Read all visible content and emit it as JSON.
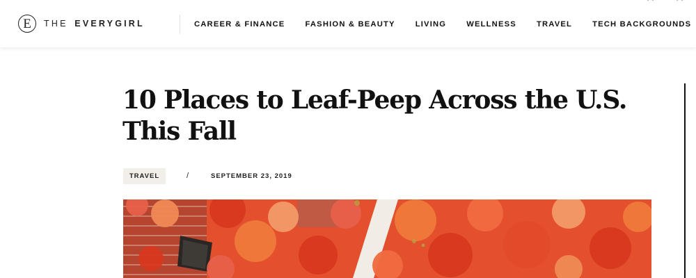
{
  "site": {
    "logo_letter": "E",
    "logo_prefix": "THE",
    "logo_name": "EVERYGIRL"
  },
  "nav": {
    "items": [
      "CAREER & FINANCE",
      "FASHION & BEAUTY",
      "LIVING",
      "WELLNESS",
      "TRAVEL",
      "TECH BACKGROUNDS"
    ]
  },
  "article": {
    "title": "10 Places to Leaf-Peep Across the U.S. This Fall",
    "category": "TRAVEL",
    "separator": "/",
    "date": "SEPTEMBER 23, 2019"
  },
  "hero": {
    "subject": "red autumn ivy on brick wall"
  },
  "colors": {
    "accent_badge_bg": "#f2eee9",
    "ivy_red": "#d8381f",
    "ivy_orange": "#f07a3a",
    "brick": "#b5452f"
  }
}
